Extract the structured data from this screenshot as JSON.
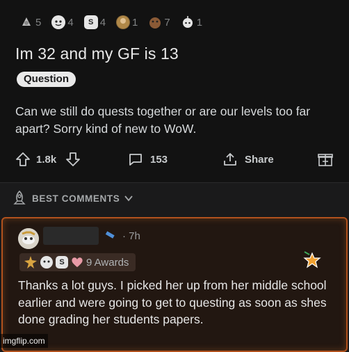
{
  "post": {
    "award_counts": [
      "5",
      "4",
      "4",
      "1",
      "7",
      "1"
    ],
    "title": "Im 32 and my GF is 13",
    "flair": "Question",
    "body": "Can we still do quests together or are our levels too far apart? Sorry kind of new to WoW.",
    "actions": {
      "upvotes": "1.8k",
      "comments": "153",
      "share": "Share"
    }
  },
  "sort": {
    "label": "BEST COMMENTS"
  },
  "comment": {
    "time": "· 7h",
    "awards_label": "9 Awards",
    "text": "Thanks a lot guys. I picked her up from her middle school earlier and were going to get to questing as soon as shes done grading her students papers."
  },
  "watermark": "imgflip.com",
  "colors": {
    "comment_border": "#b2521d",
    "comment_bg": "#221711",
    "post_bg": "#121212"
  }
}
